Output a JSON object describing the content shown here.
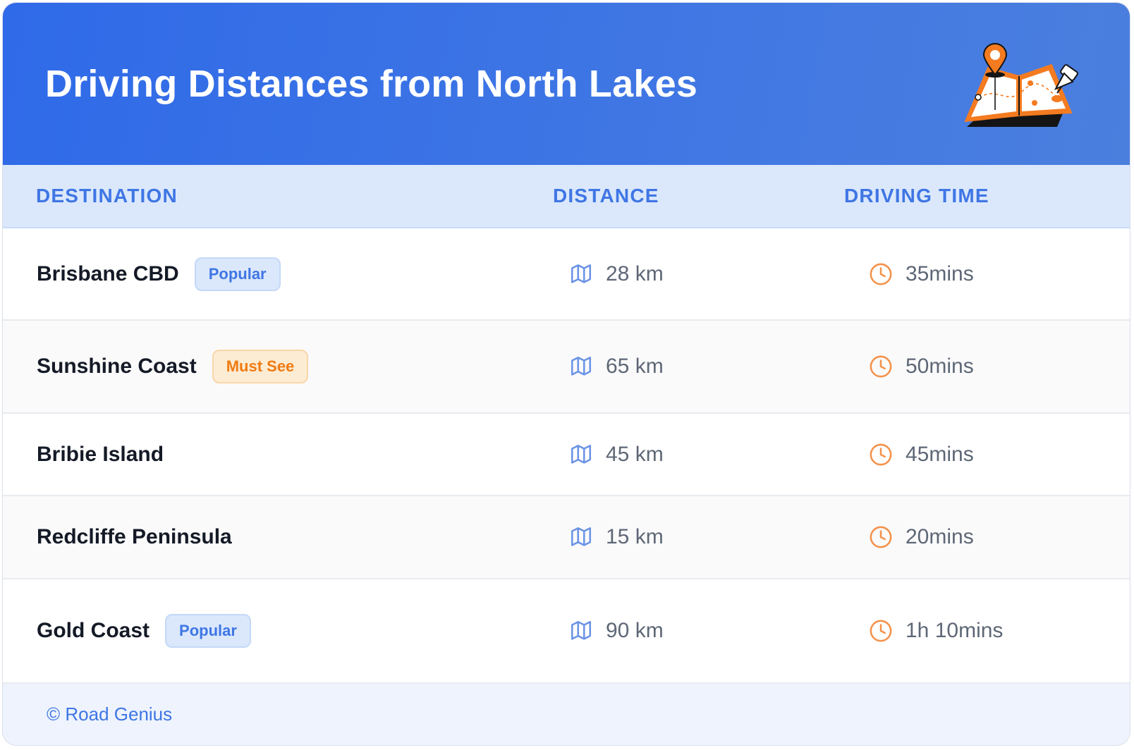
{
  "header": {
    "title": "Driving Distances from North Lakes",
    "illustration_icon": "folded-map-with-pins-icon"
  },
  "table": {
    "columns": [
      "DESTINATION",
      "DISTANCE",
      "DRIVING TIME"
    ],
    "distance_icon": "map-icon",
    "time_icon": "clock-icon",
    "rows": [
      {
        "destination": "Brisbane CBD",
        "badge": "Popular",
        "badge_type": "popular",
        "distance": "28 km",
        "time": "35mins"
      },
      {
        "destination": "Sunshine Coast",
        "badge": "Must See",
        "badge_type": "mustsee",
        "distance": "65 km",
        "time": "50mins"
      },
      {
        "destination": "Bribie Island",
        "badge": "",
        "badge_type": "",
        "distance": "45 km",
        "time": "45mins"
      },
      {
        "destination": "Redcliffe Peninsula",
        "badge": "",
        "badge_type": "",
        "distance": "15 km",
        "time": "20mins"
      },
      {
        "destination": "Gold Coast",
        "badge": "Popular",
        "badge_type": "popular",
        "distance": "90 km",
        "time": "1h 10mins"
      }
    ]
  },
  "footer": {
    "text": "© Road Genius"
  },
  "colors": {
    "header_gradient_start": "#2f6ae8",
    "header_gradient_end": "#4b7fde",
    "accent_blue": "#3f76e4",
    "accent_orange": "#f07b12",
    "table_header_bg": "#dbe8fc",
    "footer_bg": "#eef3fd"
  }
}
